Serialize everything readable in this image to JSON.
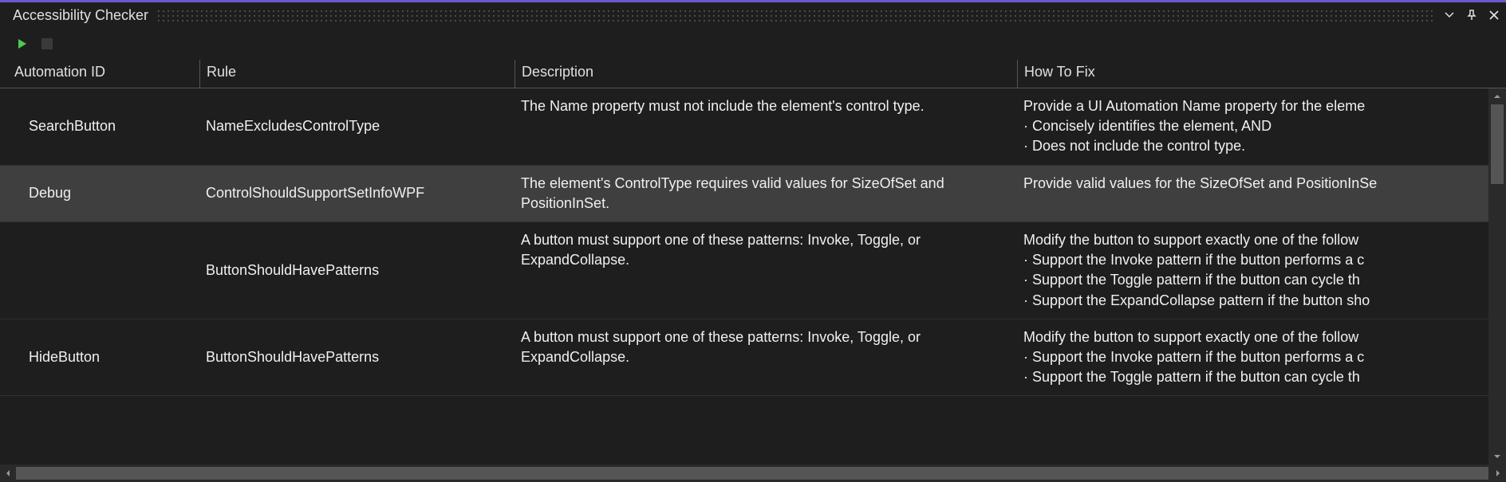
{
  "panel": {
    "title": "Accessibility Checker"
  },
  "columns": {
    "automation_id": "Automation ID",
    "rule": "Rule",
    "description": "Description",
    "how_to_fix": "How To Fix"
  },
  "rows": [
    {
      "automation_id": "SearchButton",
      "rule": "NameExcludesControlType",
      "description": "The Name property must not include the element's control type.",
      "how_to_fix": "Provide a UI Automation Name property for the eleme\n · Concisely identifies the element, AND\n · Does not include the control type."
    },
    {
      "automation_id": "Debug",
      "rule": "ControlShouldSupportSetInfoWPF",
      "description": "The element's ControlType requires valid values for SizeOfSet and PositionInSet.",
      "how_to_fix": "Provide valid values for the SizeOfSet and PositionInSe"
    },
    {
      "automation_id": "",
      "rule": "ButtonShouldHavePatterns",
      "description": "A button must support one of these patterns: Invoke, Toggle, or ExpandCollapse.",
      "how_to_fix": "Modify the button to support exactly one of the follow\n · Support the Invoke pattern if the button performs a c\n · Support the Toggle pattern if the button can cycle th\n · Support the ExpandCollapse pattern if the button sho"
    },
    {
      "automation_id": "HideButton",
      "rule": "ButtonShouldHavePatterns",
      "description": "A button must support one of these patterns: Invoke, Toggle, or ExpandCollapse.",
      "how_to_fix": "Modify the button to support exactly one of the follow\n · Support the Invoke pattern if the button performs a c\n · Support the Toggle pattern if the button can cycle th"
    }
  ],
  "selected_row_index": 1
}
